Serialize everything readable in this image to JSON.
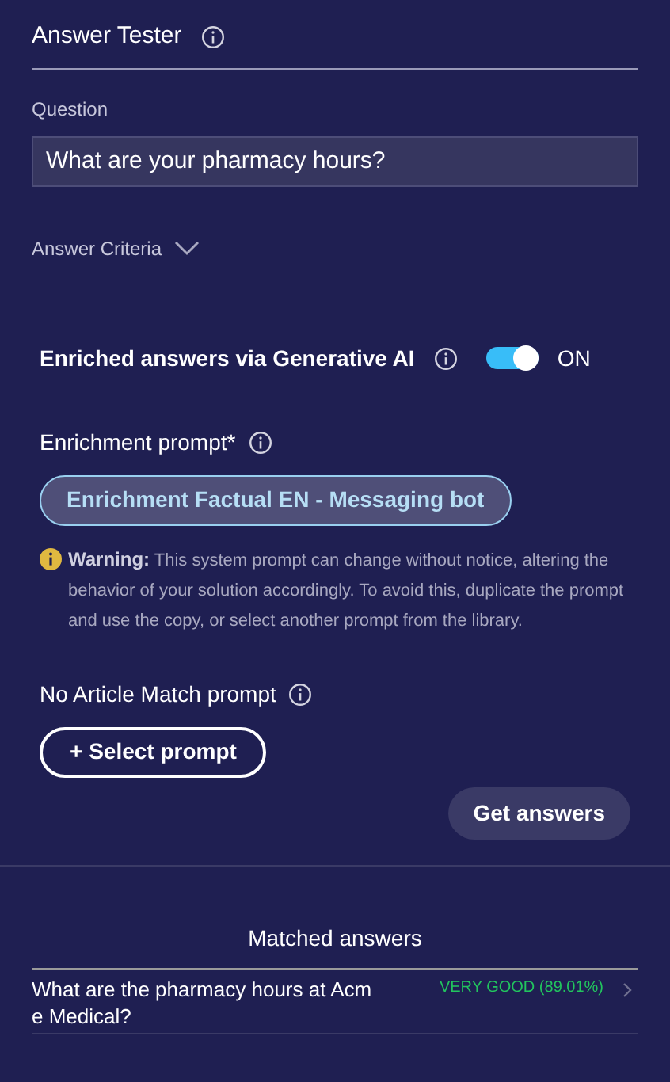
{
  "header": {
    "title": "Answer Tester"
  },
  "question": {
    "label": "Question",
    "value": "What are your pharmacy hours?"
  },
  "answer_criteria": {
    "label": "Answer Criteria",
    "expanded": false
  },
  "enrichment": {
    "label": "Enriched answers via Generative AI",
    "on": true,
    "toggle_label": "ON"
  },
  "enrichment_prompt": {
    "label": "Enrichment prompt*",
    "value": "Enrichment Factual EN - Messaging bot"
  },
  "warning": "**Warning:** This system prompt can change without notice, altering the behavior of your solution accordingly. To avoid this, duplicate the prompt and use the copy, or select another prompt from the library.",
  "no_match_prompt": {
    "label": "No Article Match prompt",
    "button": "+ Select prompt"
  },
  "get_answers_button": "Get answers",
  "matched": {
    "title": "Matched answers",
    "rows": [
      {
        "question": "What are the pharmacy hours at Acme Medical?",
        "rating": "VERY GOOD (89.01%)",
        "color": "#22c55e"
      }
    ]
  }
}
